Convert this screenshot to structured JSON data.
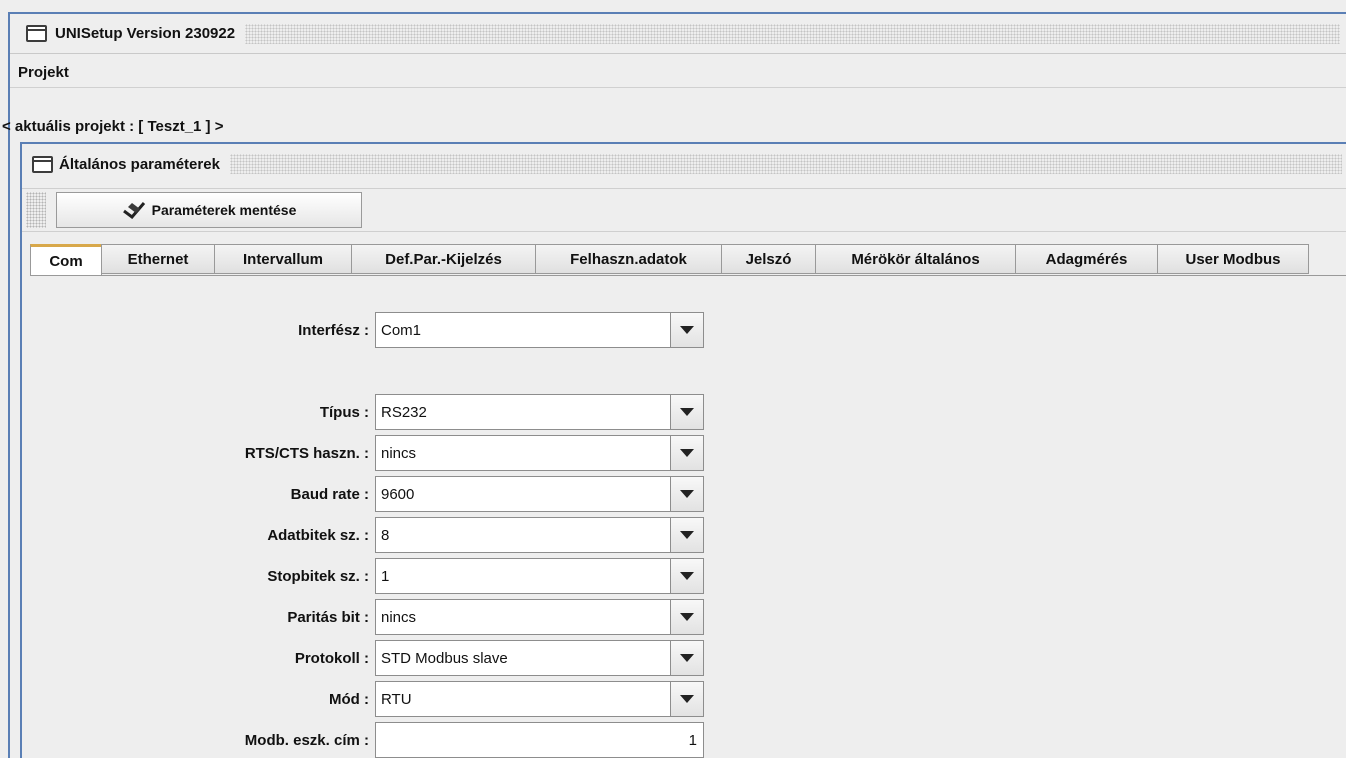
{
  "window": {
    "title": "UNISetup Version 230922"
  },
  "menu": {
    "items": [
      {
        "label": "Projekt"
      }
    ]
  },
  "project_line": "< aktuális projekt : [ Teszt_1 ] >",
  "inner_window": {
    "title": "Általános paraméterek"
  },
  "toolbar": {
    "save_label": "Paraméterek mentése"
  },
  "tabs": [
    {
      "label": "Com",
      "active": true
    },
    {
      "label": "Ethernet",
      "active": false
    },
    {
      "label": "Intervallum",
      "active": false
    },
    {
      "label": "Def.Par.-Kijelzés",
      "active": false
    },
    {
      "label": "Felhaszn.adatok",
      "active": false
    },
    {
      "label": "Jelszó",
      "active": false
    },
    {
      "label": "Mérökör általános",
      "active": false
    },
    {
      "label": "Adagmérés",
      "active": false
    },
    {
      "label": "User Modbus",
      "active": false
    }
  ],
  "form": {
    "interface": {
      "label": "Interfész :",
      "value": "Com1"
    },
    "type": {
      "label": "Típus :",
      "value": "RS232"
    },
    "rts_cts": {
      "label": "RTS/CTS haszn. :",
      "value": "nincs"
    },
    "baud": {
      "label": "Baud rate :",
      "value": "9600"
    },
    "data_bits": {
      "label": "Adatbitek sz. :",
      "value": "8"
    },
    "stop_bits": {
      "label": "Stopbitek sz. :",
      "value": "1"
    },
    "parity": {
      "label": "Paritás bit :",
      "value": "nincs"
    },
    "protocol": {
      "label": "Protokoll :",
      "value": "STD Modbus slave"
    },
    "mode": {
      "label": "Mód :",
      "value": "RTU"
    },
    "modbus_addr": {
      "label": "Modb. eszk. cím :",
      "value": "1"
    }
  },
  "colors": {
    "frame_border": "#5a7fb5",
    "active_tab_accent": "#d8a84a",
    "background": "#eeeeee"
  },
  "icons": {
    "window": "window-icon",
    "save": "save-icon",
    "dropdown": "chevron-down-icon"
  }
}
